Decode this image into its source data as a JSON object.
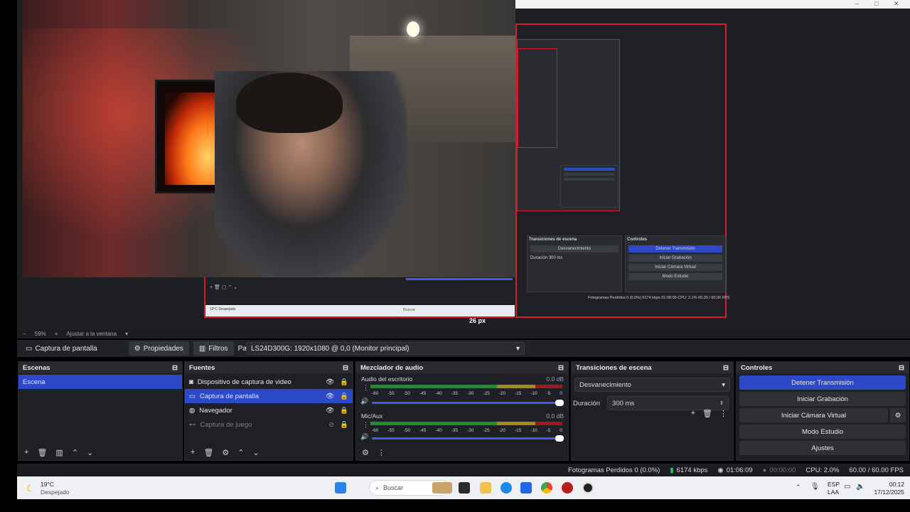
{
  "nested_window": {
    "controls": [
      "–",
      "□",
      "✕"
    ]
  },
  "preview": {
    "nested_labels": {
      "transitions": "Transiciones de escena",
      "controls": "Controles",
      "fade": "Desvanecimiento",
      "duration_label": "Duración",
      "duration_value": "300 ms",
      "stop_stream": "Detener Transmisión",
      "start_record": "Iniciar Grabación",
      "start_vcam": "Iniciar Cámara Virtual",
      "studio_mode": "Modo Estudio",
      "settings": "Ajustes",
      "status": "Fotogramas Perdidos 0 (0.0%)   6174 kbps   01:08:09   CPU: 2.1%   60.00 / 60.00 FPS",
      "taskbar_search": "Buscar",
      "tray": "ESP LAA",
      "weather": "19°C Despejado"
    },
    "px_label": "26 px"
  },
  "zoom": {
    "minus": "−",
    "value": "59%",
    "plus": "+",
    "fit": "Ajustar a la ventana"
  },
  "propbar": {
    "source_name": "Captura de pantalla",
    "properties": "Propiedades",
    "filters": "Filtros",
    "display_label": "Pantalla",
    "display_value": "LS24D300G: 1920x1080 @ 0,0 (Monitor principal)"
  },
  "scenes": {
    "title": "Escenas",
    "items": [
      "Escena"
    ]
  },
  "sources": {
    "title": "Fuentes",
    "items": [
      {
        "label": "Dispositivo de captura de video",
        "icon": "camera-icon"
      },
      {
        "label": "Captura de pantalla",
        "icon": "monitor-icon"
      },
      {
        "label": "Navegador",
        "icon": "globe-icon"
      },
      {
        "label": "Captura de juego",
        "icon": "gamepad-icon"
      }
    ]
  },
  "mixer": {
    "title": "Mezclador de audio",
    "channels": [
      {
        "name": "Audio del escritorio",
        "db": "0.0 dB"
      },
      {
        "name": "Mic/Aux",
        "db": "0.0 dB"
      }
    ],
    "ticks": [
      "-60",
      "-55",
      "-50",
      "-45",
      "-40",
      "-35",
      "-30",
      "-25",
      "-20",
      "-15",
      "-10",
      "-5",
      "0"
    ]
  },
  "transitions": {
    "title": "Transiciones de escena",
    "selected": "Desvanecimiento",
    "duration_label": "Duración",
    "duration_value": "300 ms"
  },
  "controls": {
    "title": "Controles",
    "stop_stream": "Detener Transmisión",
    "start_record": "Iniciar Grabación",
    "start_vcam": "Iniciar Cámara Virtual",
    "studio_mode": "Modo Estudio",
    "settings": "Ajustes"
  },
  "status": {
    "dropped": "Fotogramas Perdidos 0 (0.0%)",
    "bitrate": "6174 kbps",
    "stream_time": "01:06:09",
    "record_time": "00:00:00",
    "cpu": "CPU: 2.0%",
    "fps": "60.00 / 60.00 FPS"
  },
  "taskbar": {
    "temp": "19°C",
    "weather": "Despejado",
    "search": "Buscar",
    "lang1": "ESP",
    "lang2": "LAA",
    "time": "00:12",
    "date": "17/12/2025"
  },
  "colors": {
    "accent": "#2d49c8",
    "border": "#d51b2b",
    "meter_green": "#1e8f2a",
    "meter_yellow": "#a38a1c",
    "meter_red": "#a3181d"
  }
}
